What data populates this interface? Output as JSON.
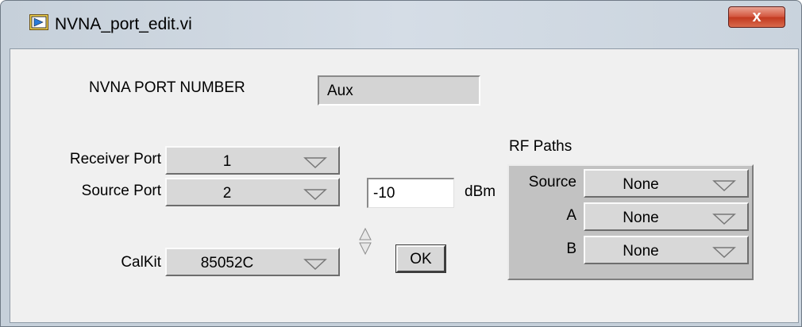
{
  "window": {
    "title": "NVNA_port_edit.vi",
    "close_label": "x"
  },
  "port_number": {
    "label": "NVNA PORT NUMBER",
    "value": "Aux"
  },
  "receiver_port": {
    "label": "Receiver Port",
    "value": "1"
  },
  "source_port": {
    "label": "Source Port",
    "value": "2"
  },
  "power": {
    "value": "-10",
    "unit": "dBm"
  },
  "calkit": {
    "label": "CalKit",
    "value": "85052C"
  },
  "ok_button": {
    "label": "OK"
  },
  "rf_paths": {
    "title": "RF Paths",
    "rows": [
      {
        "label": "Source",
        "value": "None"
      },
      {
        "label": "A",
        "value": "None"
      },
      {
        "label": "B",
        "value": "None"
      }
    ]
  },
  "colors": {
    "title_bar": "#c6d0da",
    "panel": "#f0f0f0",
    "control": "#d8d8d8",
    "close_button": "#c23a20"
  },
  "icons": [
    "labview-vi-icon",
    "close-icon",
    "dropdown-arrow-icon",
    "increment-decrement-icon"
  ]
}
